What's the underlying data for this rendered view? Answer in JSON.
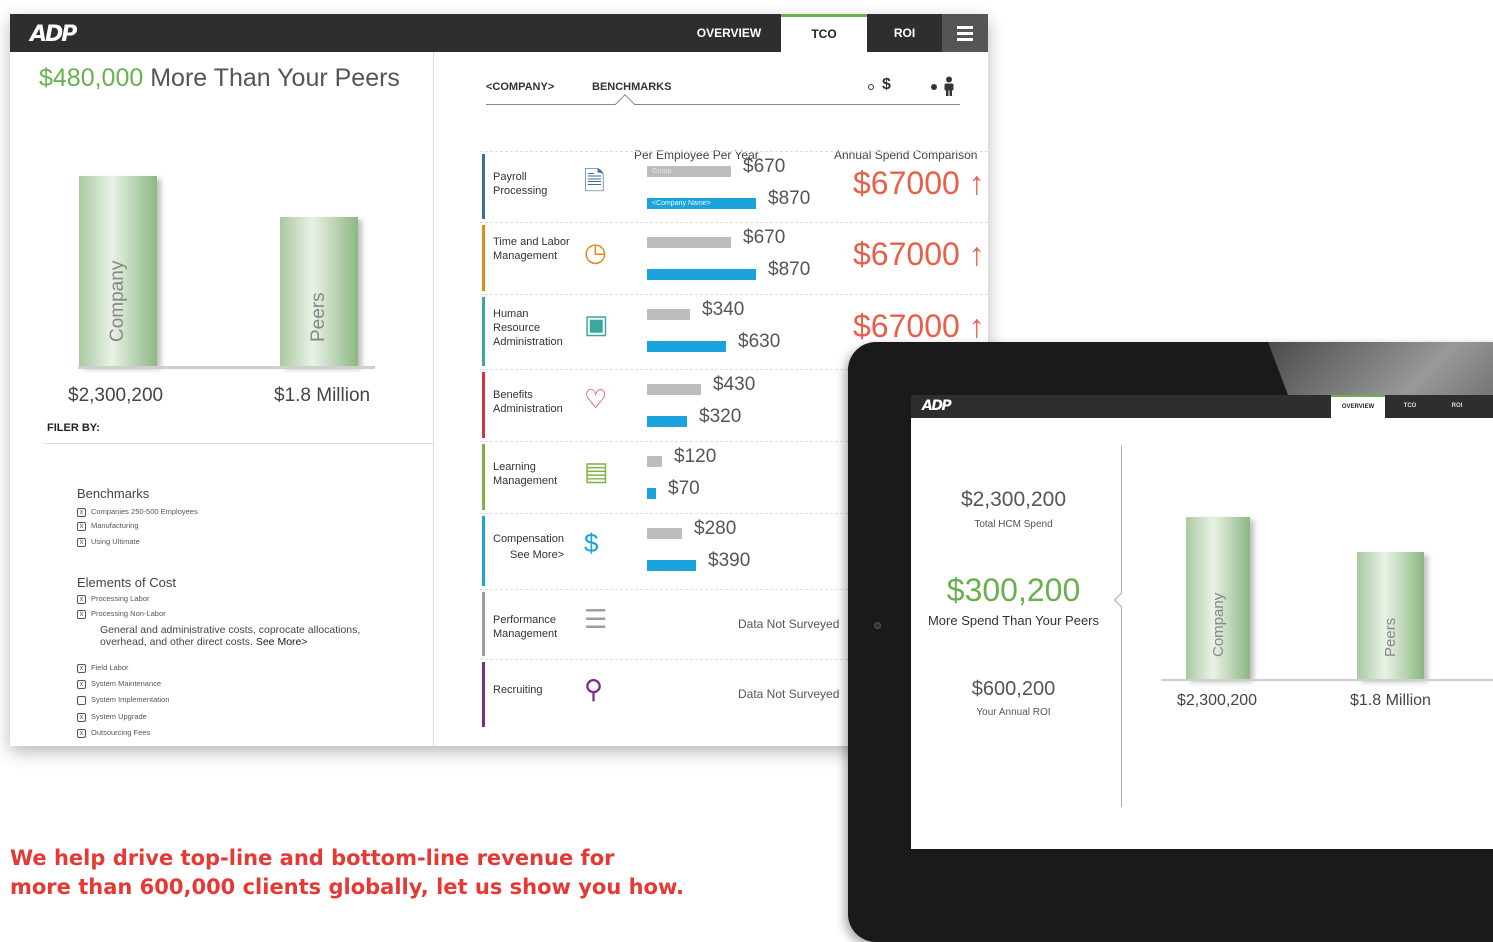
{
  "desktop": {
    "logo": "ADP",
    "nav": {
      "overview": "OVERVIEW",
      "tco": "TCO",
      "roi": "ROI",
      "active": "TCO"
    },
    "headline": {
      "amount": "$480,000",
      "text": "More Than Your Peers"
    },
    "chart_data": {
      "type": "bar",
      "categories": [
        "Company",
        "Peers"
      ],
      "values": [
        2300200,
        1800000
      ],
      "value_labels": [
        "$2,300,200",
        "$1.8 Million"
      ]
    },
    "filter": {
      "title": "FILER BY:",
      "benchmarks": {
        "label": "Benchmarks",
        "items": [
          "Companies 250-500 Employees",
          "Manufacturing",
          "Using Ultimate"
        ]
      },
      "elements": {
        "label": "Elements of Cost",
        "items_a": [
          "Processing Labor",
          "Processing Non-Labor"
        ],
        "description": "General and administrative costs, coprocate allocations, overhead, and other direct costs.",
        "see_more": "See More>",
        "items_b": [
          {
            "label": "Field Labor",
            "checked": true
          },
          {
            "label": "System Maintenance",
            "checked": true
          },
          {
            "label": "System Implementation",
            "checked": false
          },
          {
            "label": "System Upgrade",
            "checked": true
          },
          {
            "label": "Outsourcing Fees",
            "checked": true
          }
        ]
      }
    },
    "subnav": {
      "company": "<COMPANY>",
      "benchmarks": "BENCHMARKS",
      "currency_icon": "$",
      "person_icon": "person-icon"
    },
    "columns": {
      "per_employee": "Per Employee Per Year",
      "annual": "Annual Spend Comparison"
    },
    "bar_labels": {
      "group": "Group",
      "company": "<Company Name>"
    },
    "rows": [
      {
        "label": "Payroll Processing",
        "icon": "payroll-icon",
        "color": "#3b6ea5",
        "group": "$670",
        "company": "$870",
        "group_value": 670,
        "company_value": 870,
        "annual": "$67000 ↑"
      },
      {
        "label": "Time and Labor Management",
        "icon": "clock-icon",
        "color": "#e08a1e",
        "group": "$670",
        "company": "$870",
        "group_value": 670,
        "company_value": 870,
        "annual": "$67000 ↑"
      },
      {
        "label": "Human Resource Administration",
        "icon": "hr-file-icon",
        "color": "#3aa7a0",
        "group": "$340",
        "company": "$630",
        "group_value": 340,
        "company_value": 630,
        "annual": "$67000 ↑"
      },
      {
        "label": "Benefits Administration",
        "icon": "heart-icon",
        "color": "#d9333f",
        "group": "$430",
        "company": "$320",
        "group_value": 430,
        "company_value": 320
      },
      {
        "label": "Learning Management",
        "icon": "laptop-icon",
        "color": "#7cb342",
        "group": "$120",
        "company": "$70",
        "group_value": 120,
        "company_value": 70
      },
      {
        "label": "Compensation",
        "sublabel": "See More>",
        "icon": "cash-icon",
        "color": "#1ba4dc",
        "group": "$280",
        "company": "$390",
        "group_value": 280,
        "company_value": 390
      },
      {
        "label": "Performance Management",
        "icon": "bar-chart-icon",
        "color": "#9e9e9e",
        "nodata": "Data Not Surveyed"
      },
      {
        "label": "Recruiting",
        "icon": "recruiting-icon",
        "color": "#7b2d8e",
        "nodata": "Data Not Surveyed"
      }
    ]
  },
  "tablet": {
    "logo": "ADP",
    "nav": {
      "overview": "OVERVIEW",
      "tco": "TCO",
      "roi": "ROI",
      "active": "OVERVIEW"
    },
    "total": {
      "value": "$2,300,200",
      "label": "Total HCM Spend"
    },
    "peers": {
      "value": "$300,200",
      "label": "More Spend Than Your Peers"
    },
    "roi": {
      "value": "$600,200",
      "label": "Your Annual ROI"
    },
    "chart_data": {
      "type": "bar",
      "categories": [
        "Company",
        "Peers"
      ],
      "values": [
        2300200,
        1800000
      ],
      "value_labels": [
        "$2,300,200",
        "$1.8 Million"
      ]
    }
  },
  "tagline": {
    "line1": "We help drive top-line and bottom-line revenue for",
    "line2": "more than 600,000 clients globally, let us show you how."
  },
  "colors": {
    "green": "#6ab04c",
    "red": "#e8604a",
    "blue": "#1ba4dc",
    "bar_gray": "#bdbdbd",
    "tagline": "#e53935"
  }
}
